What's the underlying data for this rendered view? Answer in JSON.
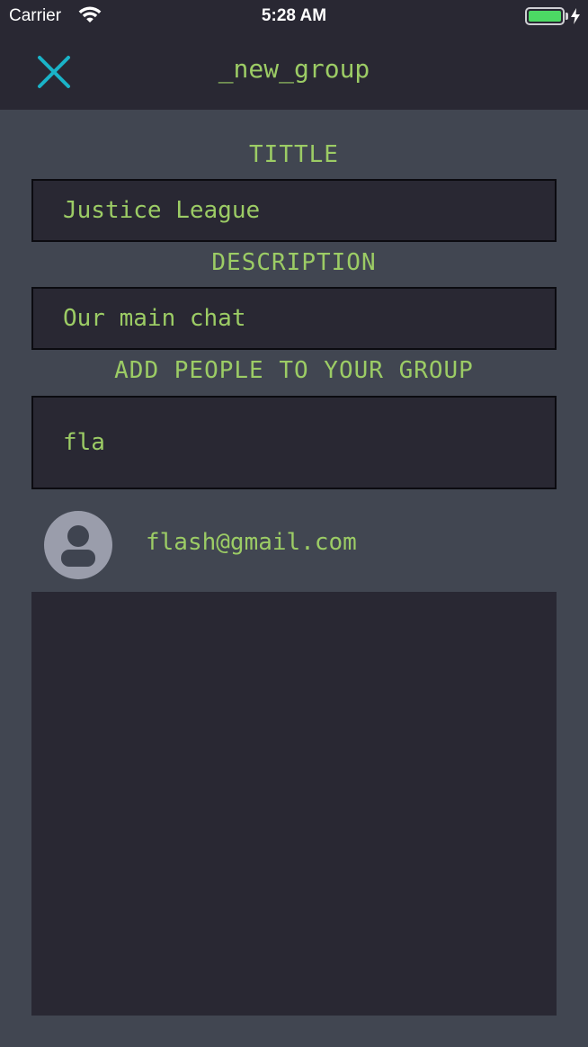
{
  "status_bar": {
    "carrier": "Carrier",
    "time": "5:28 AM",
    "battery_level": 1.0
  },
  "nav": {
    "title": "_new_group",
    "close_icon": "close-icon"
  },
  "form": {
    "title_label": "TITTLE",
    "title_value": "Justice League",
    "description_label": "DESCRIPTION",
    "description_value": "Our main chat",
    "add_people_label": "ADD PEOPLE TO YOUR GROUP",
    "search_value": "fla"
  },
  "results": [
    {
      "email": "flash@gmail.com",
      "avatar_icon": "user-avatar-icon"
    }
  ],
  "colors": {
    "background": "#414651",
    "bar": "#292833",
    "accent_text": "#9ccc65",
    "close_icon": "#1ab3c8",
    "avatar": "#9a9dab"
  }
}
